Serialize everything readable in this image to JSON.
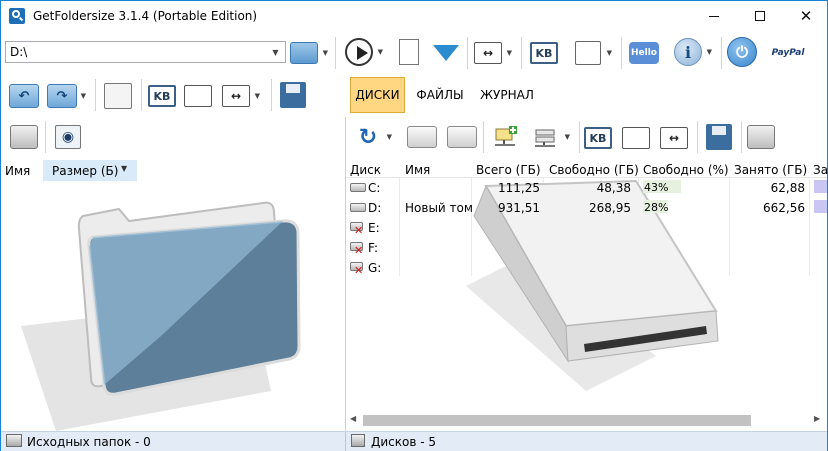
{
  "window": {
    "title": "GetFoldersize 3.1.4 (Portable Edition)",
    "minimize": "—",
    "maximize": "☐",
    "close": "✕"
  },
  "path": {
    "value": "D:\\"
  },
  "toolbar_icons": {
    "kb": "KB",
    "hello": "Hello",
    "paypal": "PayPal",
    "info": "i",
    "power": "⏻",
    "arrows": "↔"
  },
  "tabs": [
    {
      "label": "ДИСКИ",
      "active": true
    },
    {
      "label": "ФАЙЛЫ",
      "active": false
    },
    {
      "label": "ЖУРНАЛ",
      "active": false
    }
  ],
  "left_pane": {
    "columns": [
      "Имя",
      "Размер (Б)"
    ]
  },
  "drives_table": {
    "columns": [
      "Диск",
      "Имя",
      "Всего (ГБ)",
      "Свободно (ГБ)",
      "Свободно (%)",
      "Занято (ГБ)",
      "Зан"
    ],
    "rows": [
      {
        "drive": "C:",
        "name": "",
        "total": "111,25",
        "free": "48,38",
        "free_pct": "43%",
        "free_fraction": 0.43,
        "used": "62,88",
        "available": true
      },
      {
        "drive": "D:",
        "name": "Новый том",
        "total": "931,51",
        "free": "268,95",
        "free_pct": "28%",
        "free_fraction": 0.28,
        "used": "662,56",
        "available": true
      },
      {
        "drive": "E:",
        "name": "",
        "total": "",
        "free": "",
        "free_pct": "",
        "used": "",
        "available": false
      },
      {
        "drive": "F:",
        "name": "",
        "total": "",
        "free": "",
        "free_pct": "",
        "used": "",
        "available": false
      },
      {
        "drive": "G:",
        "name": "",
        "total": "",
        "free": "",
        "free_pct": "",
        "used": "",
        "available": false
      }
    ]
  },
  "status": {
    "left": "Исходных папок - 0",
    "right": "Дисков - 5"
  },
  "colors": {
    "active_tab": "#ffd782",
    "status_bar": "#e3ecf6",
    "free_bar": "#e6f2df",
    "used_bar": "#c9c6f4",
    "accent": "#1883d7"
  }
}
